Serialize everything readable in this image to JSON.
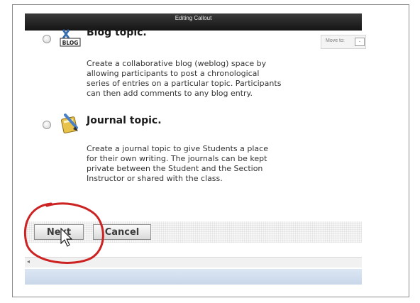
{
  "window": {
    "title": "Editing Callout"
  },
  "toolbar": {
    "move_to_label": "Move to:",
    "move_to_value": "-"
  },
  "options": [
    {
      "id": "blog",
      "icon": "blog-icon",
      "icon_text": "BLOG",
      "heading": "Blog topic.",
      "description_lines": [
        "Create a collaborative blog (weblog) space by",
        "allowing participants to post a chronological",
        "series of entries on a particular topic. Participants",
        "can then add comments to any blog entry."
      ]
    },
    {
      "id": "journal",
      "icon": "journal-icon",
      "heading": "Journal topic.",
      "description_lines": [
        "Create a journal topic to give Students a place",
        "for their own writing. The journals can be kept",
        "private between the Student and the Section",
        "Instructor or shared with the class."
      ]
    }
  ],
  "buttons": {
    "next": "Next",
    "cancel": "Cancel"
  },
  "scrollbar": {
    "left_arrow": "◂"
  },
  "colors": {
    "annotation": "#cc2222",
    "titlebar": "#1e1e1e",
    "statusbar": "#d2deee"
  }
}
